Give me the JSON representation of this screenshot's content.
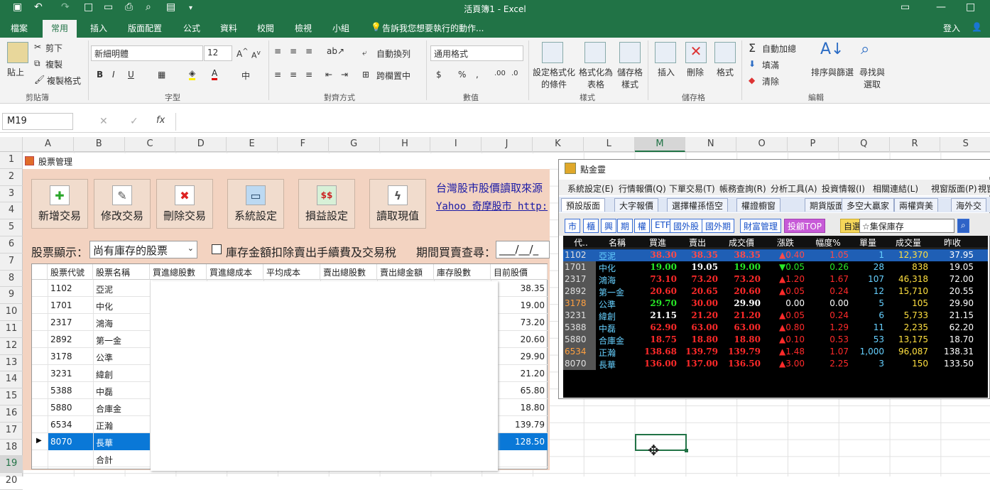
{
  "app": {
    "title": "活頁簿1 - Excel",
    "signin": "登入"
  },
  "ribbon_tabs": [
    "檔案",
    "常用",
    "插入",
    "版面配置",
    "公式",
    "資料",
    "校閱",
    "檢視",
    "小組"
  ],
  "tell_me": "告訴我您想要執行的動作...",
  "ribbon": {
    "paste": "貼上",
    "cut": "剪下",
    "copy": "複製",
    "format_painter": "複製格式",
    "clipboard": "剪貼簿",
    "font_name": "新細明體",
    "font_size": "12",
    "font_group": "字型",
    "wrap": "自動換列",
    "merge": "跨欄置中",
    "align_group": "對齊方式",
    "number_format": "通用格式",
    "number_group": "數值",
    "cond_format": "設定格式化的條件",
    "format_table": "格式化為表格",
    "cell_styles": "儲存格樣式",
    "styles_group": "樣式",
    "insert": "插入",
    "delete": "刪除",
    "format": "格式",
    "cells_group": "儲存格",
    "autosum": "自動加總",
    "fill": "填滿",
    "clear": "清除",
    "sort": "排序與篩選",
    "find": "尋找與選取",
    "edit_group": "編輯"
  },
  "namebox": "M19",
  "fx": "fx",
  "columns": [
    "A",
    "B",
    "C",
    "D",
    "E",
    "F",
    "G",
    "H",
    "I",
    "J",
    "K",
    "L",
    "M",
    "N",
    "O",
    "P",
    "Q",
    "R",
    "S"
  ],
  "rows": [
    "1",
    "2",
    "3",
    "4",
    "5",
    "6",
    "7",
    "8",
    "9",
    "10",
    "11",
    "12",
    "13",
    "14",
    "15",
    "16",
    "17",
    "18",
    "19",
    "20"
  ],
  "stock": {
    "title": "股票管理",
    "buttons": [
      "新增交易",
      "修改交易",
      "刪除交易",
      "系統設定",
      "損益設定",
      "讀取現值"
    ],
    "source_text": "台灣股市股價讀取來源",
    "source_link": "Yahoo 奇摩股市 http:",
    "display_label": "股票顯示：",
    "display_value": "尚有庫存的股票",
    "deduct_label": "庫存金額扣除賣出手續費及交易稅",
    "period_label": "期間買賣查尋：",
    "period_value": "___/__/_",
    "headers": [
      "股票代號",
      "股票名稱",
      "買進總股數",
      "買進總成本",
      "平均成本",
      "賣出總股數",
      "賣出總金額",
      "庫存股數",
      "目前股價"
    ],
    "rows": [
      {
        "code": "1102",
        "name": "亞泥",
        "price": "38.35"
      },
      {
        "code": "1701",
        "name": "中化",
        "price": "19.00"
      },
      {
        "code": "2317",
        "name": "鴻海",
        "price": "73.20"
      },
      {
        "code": "2892",
        "name": "第一金",
        "price": "20.60"
      },
      {
        "code": "3178",
        "name": "公準",
        "price": "29.90"
      },
      {
        "code": "3231",
        "name": "緯創",
        "price": "21.20"
      },
      {
        "code": "5388",
        "name": "中磊",
        "price": "65.80"
      },
      {
        "code": "5880",
        "name": "合庫金",
        "price": "18.80"
      },
      {
        "code": "6534",
        "name": "正瀚",
        "price": "139.79"
      },
      {
        "code": "8070",
        "name": "長華",
        "price": "128.50"
      },
      {
        "code": "",
        "name": "合計",
        "price": ""
      }
    ]
  },
  "gold": {
    "title": "點金靈",
    "menu": [
      "系統設定(E)",
      "行情報價(Q)",
      "下單交易(T)",
      "帳務查詢(R)",
      "分析工具(A)",
      "投資情報(I)",
      "相關連結(L)",
      "視窗版面(P)",
      "視窗"
    ],
    "tabs": [
      "預設版面",
      "大字報價",
      "選擇權孫悟空",
      "權證櫥窗",
      "期貨版面",
      "多空大贏家",
      "兩權齊美",
      "海外交"
    ],
    "tools": [
      "市",
      "櫃",
      "興",
      "期",
      "權",
      "ETF",
      "國外股",
      "國外期",
      "財富管理",
      "投顧TOP",
      "自選"
    ],
    "watchlist": "☆集保庫存",
    "headers": [
      "代..",
      "名稱",
      "買進",
      "賣出",
      "成交價",
      "漲跌",
      "幅度%",
      "單量",
      "成交量",
      "昨收"
    ],
    "rows": [
      {
        "code": "1102",
        "name": "亞泥",
        "bid": "38.30",
        "ask": "38.35",
        "last": "38.35",
        "chg": "▲0.40",
        "pct": "1.05",
        "vol": "1",
        "total": "12,370",
        "prev": "37.95"
      },
      {
        "code": "1701",
        "name": "中化",
        "bid": "19.00",
        "ask": "19.05",
        "last": "19.00",
        "chg": "▼0.05",
        "pct": "0.26",
        "vol": "28",
        "total": "838",
        "prev": "19.05"
      },
      {
        "code": "2317",
        "name": "鴻海",
        "bid": "73.10",
        "ask": "73.20",
        "last": "73.20",
        "chg": "▲1.20",
        "pct": "1.67",
        "vol": "107",
        "total": "46,318",
        "prev": "72.00"
      },
      {
        "code": "2892",
        "name": "第一金",
        "bid": "20.60",
        "ask": "20.65",
        "last": "20.60",
        "chg": "▲0.05",
        "pct": "0.24",
        "vol": "12",
        "total": "15,710",
        "prev": "20.55"
      },
      {
        "code": "3178",
        "name": "公準",
        "bid": "29.70",
        "ask": "30.00",
        "last": "29.90",
        "chg": "0.00",
        "pct": "0.00",
        "vol": "5",
        "total": "105",
        "prev": "29.90"
      },
      {
        "code": "3231",
        "name": "緯創",
        "bid": "21.15",
        "ask": "21.20",
        "last": "21.20",
        "chg": "▲0.05",
        "pct": "0.24",
        "vol": "6",
        "total": "5,733",
        "prev": "21.15"
      },
      {
        "code": "5388",
        "name": "中磊",
        "bid": "62.90",
        "ask": "63.00",
        "last": "63.00",
        "chg": "▲0.80",
        "pct": "1.29",
        "vol": "11",
        "total": "2,235",
        "prev": "62.20"
      },
      {
        "code": "5880",
        "name": "合庫金",
        "bid": "18.75",
        "ask": "18.80",
        "last": "18.80",
        "chg": "▲0.10",
        "pct": "0.53",
        "vol": "53",
        "total": "13,175",
        "prev": "18.70"
      },
      {
        "code": "6534",
        "name": "正瀚",
        "bid": "138.68",
        "ask": "139.79",
        "last": "139.79",
        "chg": "▲1.48",
        "pct": "1.07",
        "vol": "1,000",
        "total": "96,087",
        "prev": "138.31"
      },
      {
        "code": "8070",
        "name": "長華",
        "bid": "136.00",
        "ask": "137.00",
        "last": "136.50",
        "chg": "▲3.00",
        "pct": "2.25",
        "vol": "3",
        "total": "150",
        "prev": "133.50"
      }
    ]
  },
  "colors": {
    "excel_green": "#217346",
    "up": "#ff2a2a",
    "down": "#27e827",
    "flat": "#ffffff",
    "link": "#1a1aa6"
  }
}
